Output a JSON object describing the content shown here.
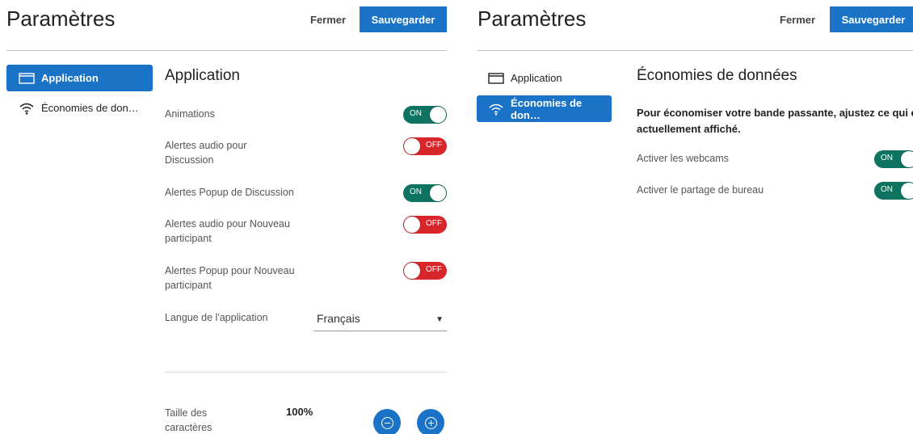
{
  "left": {
    "title": "Paramètres",
    "close_label": "Fermer",
    "save_label": "Sauvegarder",
    "nav": [
      {
        "label": "Application",
        "icon": "window-icon",
        "active": true
      },
      {
        "label": "Économies de don…",
        "icon": "wifi-icon",
        "active": false
      }
    ],
    "section_title": "Application",
    "settings": [
      {
        "label": "Animations",
        "state": "ON"
      },
      {
        "label": "Alertes audio pour Discussion",
        "state": "OFF"
      },
      {
        "label": "Alertes Popup de Discussion",
        "state": "ON"
      },
      {
        "label": "Alertes audio pour Nouveau participant",
        "state": "OFF"
      },
      {
        "label": "Alertes Popup pour Nouveau participant",
        "state": "OFF"
      }
    ],
    "language_label": "Langue de l'application",
    "language_value": "Français",
    "font_size_label": "Taille des caractères",
    "font_size_value": "100%"
  },
  "right": {
    "title": "Paramètres",
    "close_label": "Fermer",
    "save_label": "Sauvegarder",
    "nav": [
      {
        "label": "Application",
        "icon": "window-icon",
        "active": false
      },
      {
        "label": "Économies de don…",
        "icon": "wifi-icon",
        "active": true
      }
    ],
    "section_title": "Économies de données",
    "description": "Pour économiser votre bande passante, ajustez ce qui est actuellement affiché.",
    "settings": [
      {
        "label": "Activer les webcams",
        "state": "ON"
      },
      {
        "label": "Activer le partage de bureau",
        "state": "ON"
      }
    ]
  },
  "colors": {
    "accent": "#1b73c8",
    "on": "#0e7461",
    "off": "#d8262b"
  }
}
